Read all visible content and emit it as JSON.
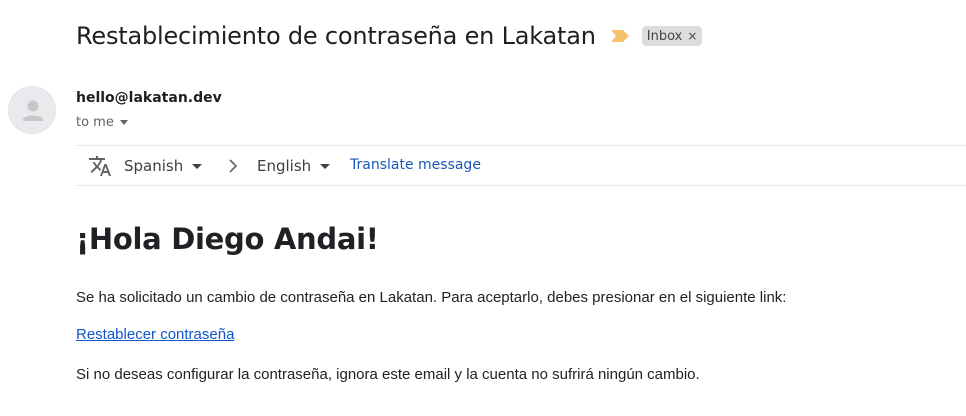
{
  "email": {
    "subject": "Restablecimiento de contraseña en Lakatan",
    "label": "Inbox",
    "label_close": "×",
    "sender": "hello@lakatan.dev",
    "recipient": "to me",
    "icons": {
      "importance": "importance-marker-icon",
      "avatar": "person-icon",
      "translate": "translate-icon",
      "chevron": "chevron-right-icon"
    },
    "colors": {
      "importance": "#f6c26b",
      "link": "#1155cc",
      "translate_link": "#1a57b8",
      "label_bg": "#dddddd"
    }
  },
  "translate_bar": {
    "source_language": "Spanish",
    "target_language": "English",
    "action": "Translate message"
  },
  "body": {
    "greeting": "¡Hola Diego Andai!",
    "paragraph1": "Se ha solicitado un cambio de contraseña en Lakatan. Para aceptarlo, debes presionar en el siguiente link:",
    "link_text": "Restablecer contraseña",
    "paragraph2": "Si no deseas configurar la contraseña, ignora este email y la cuenta no sufrirá ningún cambio."
  }
}
